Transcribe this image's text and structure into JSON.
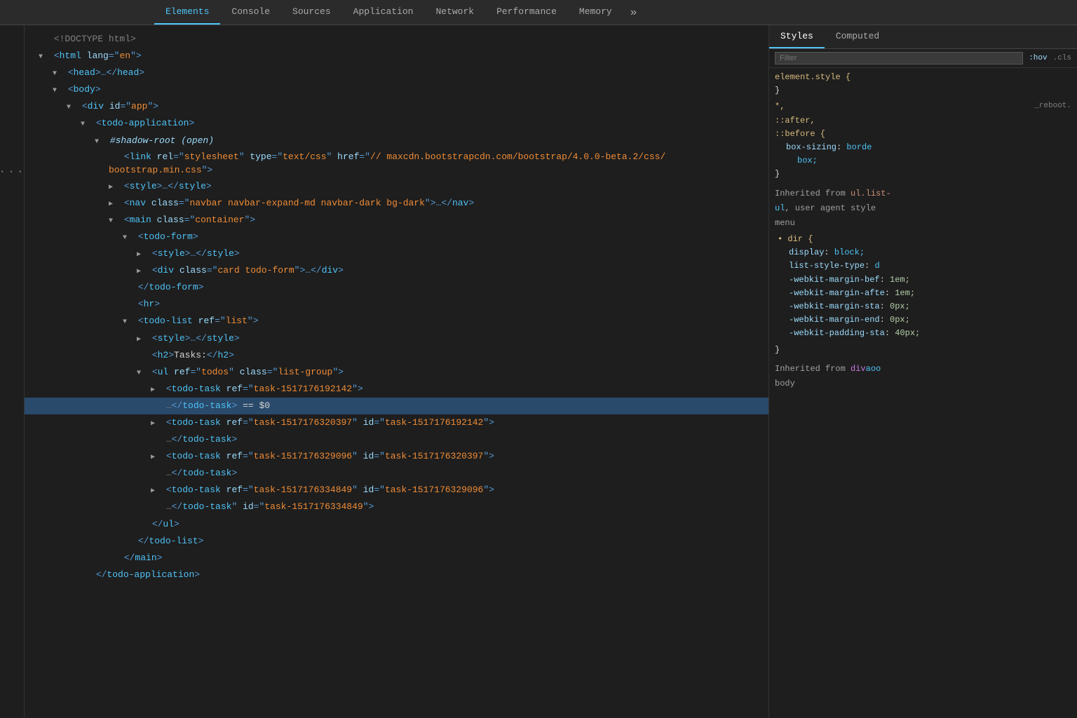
{
  "tabs": {
    "items": [
      {
        "label": "Elements",
        "active": false
      },
      {
        "label": "Console",
        "active": false
      },
      {
        "label": "Sources",
        "active": false
      },
      {
        "label": "Application",
        "active": false
      },
      {
        "label": "Network",
        "active": false
      },
      {
        "label": "Performance",
        "active": false
      },
      {
        "label": "Memory",
        "active": false
      }
    ],
    "more_label": "»"
  },
  "right_tabs": {
    "styles_label": "Styles",
    "computed_label": "Computed"
  },
  "filter": {
    "placeholder": "Filter",
    "hov_label": ":hov",
    "cls_label": ".cls"
  },
  "html_tree": [
    {
      "indent": "i0",
      "arrow": "none",
      "content": "<!DOCTYPE html>",
      "type": "doctype"
    },
    {
      "indent": "i0",
      "arrow": "open",
      "content_parts": [
        {
          "type": "tag",
          "text": "<"
        },
        {
          "type": "tagname",
          "text": "html"
        },
        {
          "type": "attr-name",
          "text": " lang"
        },
        {
          "type": "tag",
          "text": "="
        },
        {
          "type": "attr-value",
          "text": "\"en\""
        },
        {
          "type": "tag",
          "text": ">"
        }
      ]
    },
    {
      "indent": "i1",
      "arrow": "open",
      "content_parts": [
        {
          "type": "tag",
          "text": "<"
        },
        {
          "type": "tagname",
          "text": "head"
        },
        {
          "type": "tag",
          "text": ">…</"
        },
        {
          "type": "tagname",
          "text": "head"
        },
        {
          "type": "tag",
          "text": ">"
        }
      ]
    },
    {
      "indent": "i1",
      "arrow": "open",
      "content_parts": [
        {
          "type": "tag",
          "text": "<"
        },
        {
          "type": "tagname",
          "text": "body"
        },
        {
          "type": "tag",
          "text": ">"
        }
      ]
    },
    {
      "indent": "i2",
      "arrow": "open",
      "content_parts": [
        {
          "type": "tag",
          "text": "<"
        },
        {
          "type": "tagname",
          "text": "div"
        },
        {
          "type": "attr-name",
          "text": " id"
        },
        {
          "type": "tag",
          "text": "="
        },
        {
          "type": "attr-value",
          "text": "\"app\""
        },
        {
          "type": "tag",
          "text": ">"
        }
      ]
    },
    {
      "indent": "i3",
      "arrow": "open",
      "content_parts": [
        {
          "type": "tag",
          "text": "<"
        },
        {
          "type": "tagname",
          "text": "todo-application"
        },
        {
          "type": "tag",
          "text": ">"
        }
      ]
    },
    {
      "indent": "i4",
      "arrow": "open",
      "content_parts": [
        {
          "type": "shadow-root",
          "text": "#shadow-root (open)"
        }
      ]
    },
    {
      "indent": "i5",
      "arrow": "none",
      "content_parts": [
        {
          "type": "tag",
          "text": "<"
        },
        {
          "type": "tagname",
          "text": "link"
        },
        {
          "type": "attr-name",
          "text": " rel"
        },
        {
          "type": "tag",
          "text": "="
        },
        {
          "type": "attr-value",
          "text": "\"stylesheet\""
        },
        {
          "type": "attr-name",
          "text": " type"
        },
        {
          "type": "tag",
          "text": "="
        },
        {
          "type": "attr-value",
          "text": "\"text/css\""
        },
        {
          "type": "attr-name",
          "text": " href"
        },
        {
          "type": "tag",
          "text": "="
        },
        {
          "type": "attr-value",
          "text": "\"//\nmaxcdn.bootstrapcdn.com/bootstrap/4.0.0-beta.2/css/\nbootstrap.min.css\""
        },
        {
          "type": "tag",
          "text": ">"
        }
      ]
    },
    {
      "indent": "i5",
      "arrow": "closed",
      "content_parts": [
        {
          "type": "tag",
          "text": "<"
        },
        {
          "type": "tagname",
          "text": "style"
        },
        {
          "type": "tag",
          "text": ">…</"
        },
        {
          "type": "tagname",
          "text": "style"
        },
        {
          "type": "tag",
          "text": ">"
        }
      ]
    },
    {
      "indent": "i5",
      "arrow": "closed",
      "content_parts": [
        {
          "type": "tag",
          "text": "<"
        },
        {
          "type": "tagname",
          "text": "nav"
        },
        {
          "type": "attr-name",
          "text": " class"
        },
        {
          "type": "tag",
          "text": "="
        },
        {
          "type": "attr-value",
          "text": "\"navbar navbar-expand-md navbar-dark bg-dark\""
        },
        {
          "type": "tag",
          "text": ">…</"
        },
        {
          "type": "tagname",
          "text": "nav"
        },
        {
          "type": "tag",
          "text": ">"
        }
      ]
    },
    {
      "indent": "i5",
      "arrow": "open",
      "content_parts": [
        {
          "type": "tag",
          "text": "<"
        },
        {
          "type": "tagname",
          "text": "main"
        },
        {
          "type": "attr-name",
          "text": " class"
        },
        {
          "type": "tag",
          "text": "="
        },
        {
          "type": "attr-value",
          "text": "\"container\""
        },
        {
          "type": "tag",
          "text": ">"
        }
      ]
    },
    {
      "indent": "i6",
      "arrow": "open",
      "content_parts": [
        {
          "type": "tag",
          "text": "<"
        },
        {
          "type": "tagname",
          "text": "todo-form"
        },
        {
          "type": "tag",
          "text": ">"
        }
      ]
    },
    {
      "indent": "i7",
      "arrow": "closed",
      "content_parts": [
        {
          "type": "tag",
          "text": "<"
        },
        {
          "type": "tagname",
          "text": "style"
        },
        {
          "type": "tag",
          "text": ">…</"
        },
        {
          "type": "tagname",
          "text": "style"
        },
        {
          "type": "tag",
          "text": ">"
        }
      ]
    },
    {
      "indent": "i7",
      "arrow": "closed",
      "content_parts": [
        {
          "type": "tag",
          "text": "<"
        },
        {
          "type": "tagname",
          "text": "div"
        },
        {
          "type": "attr-name",
          "text": " class"
        },
        {
          "type": "tag",
          "text": "="
        },
        {
          "type": "attr-value",
          "text": "\"card todo-form\""
        },
        {
          "type": "tag",
          "text": ">…</"
        },
        {
          "type": "tagname",
          "text": "div"
        },
        {
          "type": "tag",
          "text": ">"
        }
      ]
    },
    {
      "indent": "i6",
      "arrow": "none",
      "content_parts": [
        {
          "type": "tag",
          "text": "</"
        },
        {
          "type": "tagname",
          "text": "todo-form"
        },
        {
          "type": "tag",
          "text": ">"
        }
      ]
    },
    {
      "indent": "i6",
      "arrow": "none",
      "content_parts": [
        {
          "type": "tag",
          "text": "<"
        },
        {
          "type": "tagname",
          "text": "hr"
        },
        {
          "type": "tag",
          "text": ">"
        }
      ]
    },
    {
      "indent": "i6",
      "arrow": "open",
      "content_parts": [
        {
          "type": "tag",
          "text": "<"
        },
        {
          "type": "tagname",
          "text": "todo-list"
        },
        {
          "type": "attr-name",
          "text": " ref"
        },
        {
          "type": "tag",
          "text": "="
        },
        {
          "type": "attr-value",
          "text": "\"list\""
        },
        {
          "type": "tag",
          "text": ">"
        }
      ]
    },
    {
      "indent": "i7",
      "arrow": "closed",
      "content_parts": [
        {
          "type": "tag",
          "text": "<"
        },
        {
          "type": "tagname",
          "text": "style"
        },
        {
          "type": "tag",
          "text": ">…</"
        },
        {
          "type": "tagname",
          "text": "style"
        },
        {
          "type": "tag",
          "text": ">"
        }
      ]
    },
    {
      "indent": "i7",
      "arrow": "none",
      "content_parts": [
        {
          "type": "tag",
          "text": "<"
        },
        {
          "type": "tagname",
          "text": "h2"
        },
        {
          "type": "tag",
          "text": ">"
        },
        {
          "type": "text-content",
          "text": "Tasks:"
        },
        {
          "type": "tag",
          "text": "</"
        },
        {
          "type": "tagname",
          "text": "h2"
        },
        {
          "type": "tag",
          "text": ">"
        }
      ]
    },
    {
      "indent": "i7",
      "arrow": "open",
      "content_parts": [
        {
          "type": "tag",
          "text": "<"
        },
        {
          "type": "tagname",
          "text": "ul"
        },
        {
          "type": "attr-name",
          "text": " ref"
        },
        {
          "type": "tag",
          "text": "="
        },
        {
          "type": "attr-value",
          "text": "\"todos\""
        },
        {
          "type": "attr-name",
          "text": " class"
        },
        {
          "type": "tag",
          "text": "="
        },
        {
          "type": "attr-value",
          "text": "\"list-group\""
        },
        {
          "type": "tag",
          "text": ">"
        }
      ]
    },
    {
      "indent": "i8",
      "arrow": "closed",
      "content_parts": [
        {
          "type": "tag",
          "text": "<"
        },
        {
          "type": "tagname",
          "text": "todo-task"
        },
        {
          "type": "attr-name",
          "text": " ref"
        },
        {
          "type": "tag",
          "text": "="
        },
        {
          "type": "attr-value",
          "text": "\"task-1517176192142\""
        },
        {
          "type": "tag",
          "text": ">"
        }
      ]
    },
    {
      "indent": "i8",
      "arrow": "none",
      "is_selected": true,
      "content_parts": [
        {
          "type": "ellipsis",
          "text": "…"
        },
        {
          "type": "tag",
          "text": "</"
        },
        {
          "type": "tagname",
          "text": "todo-task"
        },
        {
          "type": "tag",
          "text": ">"
        },
        {
          "type": "text-content",
          "text": " == $0"
        }
      ]
    },
    {
      "indent": "i8",
      "arrow": "closed",
      "content_parts": [
        {
          "type": "tag",
          "text": "<"
        },
        {
          "type": "tagname",
          "text": "todo-task"
        },
        {
          "type": "attr-name",
          "text": " ref"
        },
        {
          "type": "tag",
          "text": "="
        },
        {
          "type": "attr-value",
          "text": "\"task-1517176320397\""
        },
        {
          "type": "attr-name",
          "text": " id"
        },
        {
          "type": "tag",
          "text": "="
        },
        {
          "type": "attr-value",
          "text": "\"task-1517176192142\""
        },
        {
          "type": "tag",
          "text": ">"
        }
      ]
    },
    {
      "indent": "i8",
      "arrow": "none",
      "content_parts": [
        {
          "type": "ellipsis",
          "text": "…"
        },
        {
          "type": "tag",
          "text": "</"
        },
        {
          "type": "tagname",
          "text": "todo-task"
        },
        {
          "type": "tag",
          "text": ">"
        }
      ]
    },
    {
      "indent": "i8",
      "arrow": "closed",
      "content_parts": [
        {
          "type": "tag",
          "text": "<"
        },
        {
          "type": "tagname",
          "text": "todo-task"
        },
        {
          "type": "attr-name",
          "text": " ref"
        },
        {
          "type": "tag",
          "text": "="
        },
        {
          "type": "attr-value",
          "text": "\"task-1517176329096\""
        },
        {
          "type": "attr-name",
          "text": " id"
        },
        {
          "type": "tag",
          "text": "="
        },
        {
          "type": "attr-value",
          "text": "\"task-1517176320397\""
        },
        {
          "type": "tag",
          "text": ">"
        }
      ]
    },
    {
      "indent": "i8",
      "arrow": "none",
      "content_parts": [
        {
          "type": "ellipsis",
          "text": "…"
        },
        {
          "type": "tag",
          "text": "</"
        },
        {
          "type": "tagname",
          "text": "todo-task"
        },
        {
          "type": "tag",
          "text": ">"
        }
      ]
    },
    {
      "indent": "i8",
      "arrow": "closed",
      "content_parts": [
        {
          "type": "tag",
          "text": "<"
        },
        {
          "type": "tagname",
          "text": "todo-task"
        },
        {
          "type": "attr-name",
          "text": " ref"
        },
        {
          "type": "tag",
          "text": "="
        },
        {
          "type": "attr-value",
          "text": "\"task-1517176334849\""
        },
        {
          "type": "attr-name",
          "text": " id"
        },
        {
          "type": "tag",
          "text": "="
        },
        {
          "type": "attr-value",
          "text": "\"task-1517176329096\""
        },
        {
          "type": "tag",
          "text": ">"
        }
      ]
    },
    {
      "indent": "i8",
      "arrow": "none",
      "content_parts": [
        {
          "type": "ellipsis",
          "text": "…"
        },
        {
          "type": "tag",
          "text": "</"
        },
        {
          "type": "tagname",
          "text": "todo-task"
        },
        {
          "type": "tag",
          "text": ">"
        }
      ]
    },
    {
      "indent": "i7",
      "arrow": "none",
      "content_parts": [
        {
          "type": "tag",
          "text": "</"
        },
        {
          "type": "tagname",
          "text": "ul"
        },
        {
          "type": "tag",
          "text": ">"
        }
      ]
    },
    {
      "indent": "i6",
      "arrow": "none",
      "content_parts": [
        {
          "type": "tag",
          "text": "</"
        },
        {
          "type": "tagname",
          "text": "todo-list"
        },
        {
          "type": "tag",
          "text": ">"
        }
      ]
    },
    {
      "indent": "i5",
      "arrow": "none",
      "content_parts": [
        {
          "type": "tag",
          "text": "</"
        },
        {
          "type": "tagname",
          "text": "main"
        },
        {
          "type": "tag",
          "text": ">"
        }
      ]
    },
    {
      "indent": "i3",
      "arrow": "none",
      "content_parts": [
        {
          "type": "tag",
          "text": "</"
        },
        {
          "type": "tagname",
          "text": "todo-application"
        },
        {
          "type": "tag",
          "text": ">"
        }
      ]
    }
  ],
  "styles": {
    "filter_placeholder": "Filter",
    "hov": ":hov",
    "cls": ".cls",
    "rules": [
      {
        "selector": "element.style {",
        "close": "}",
        "props": []
      },
      {
        "selector": "*,\n::after,\n::before {",
        "source": "_reboot.",
        "close": "}",
        "props": [
          {
            "name": "box-sizing",
            "value": "borde",
            "value_type": "keyword"
          },
          {
            "name": "",
            "value": "box;",
            "value_type": "keyword"
          }
        ]
      }
    ],
    "inherited_sections": [
      {
        "header": "Inherited from ul.list-",
        "sub": "ul, user agent style",
        "label": "menu",
        "props": [
          {
            "name": "• dir {",
            "value": "",
            "is_header": true
          },
          {
            "name": "display",
            "value": "block;",
            "value_type": "keyword",
            "indent": true
          },
          {
            "name": "list-style-type",
            "value": "d",
            "value_type": "keyword-blue",
            "indent": true
          },
          {
            "name": "-webkit-margin-bef",
            "value": "1em;",
            "value_type": "number",
            "indent": true,
            "crossed": false
          },
          {
            "name": "-webkit-margin-afte",
            "value": "1em;",
            "value_type": "number",
            "indent": true,
            "crossed": false
          },
          {
            "name": "-webkit-margin-sta",
            "value": "0px;",
            "value_type": "number",
            "indent": true,
            "crossed": false
          },
          {
            "name": "-webkit-margin-end",
            "value": "0px;",
            "value_type": "number",
            "indent": true,
            "crossed": false
          },
          {
            "name": "-webkit-padding-sta",
            "value": "40px;",
            "value_type": "number",
            "indent": true,
            "crossed": false
          }
        ]
      }
    ]
  }
}
